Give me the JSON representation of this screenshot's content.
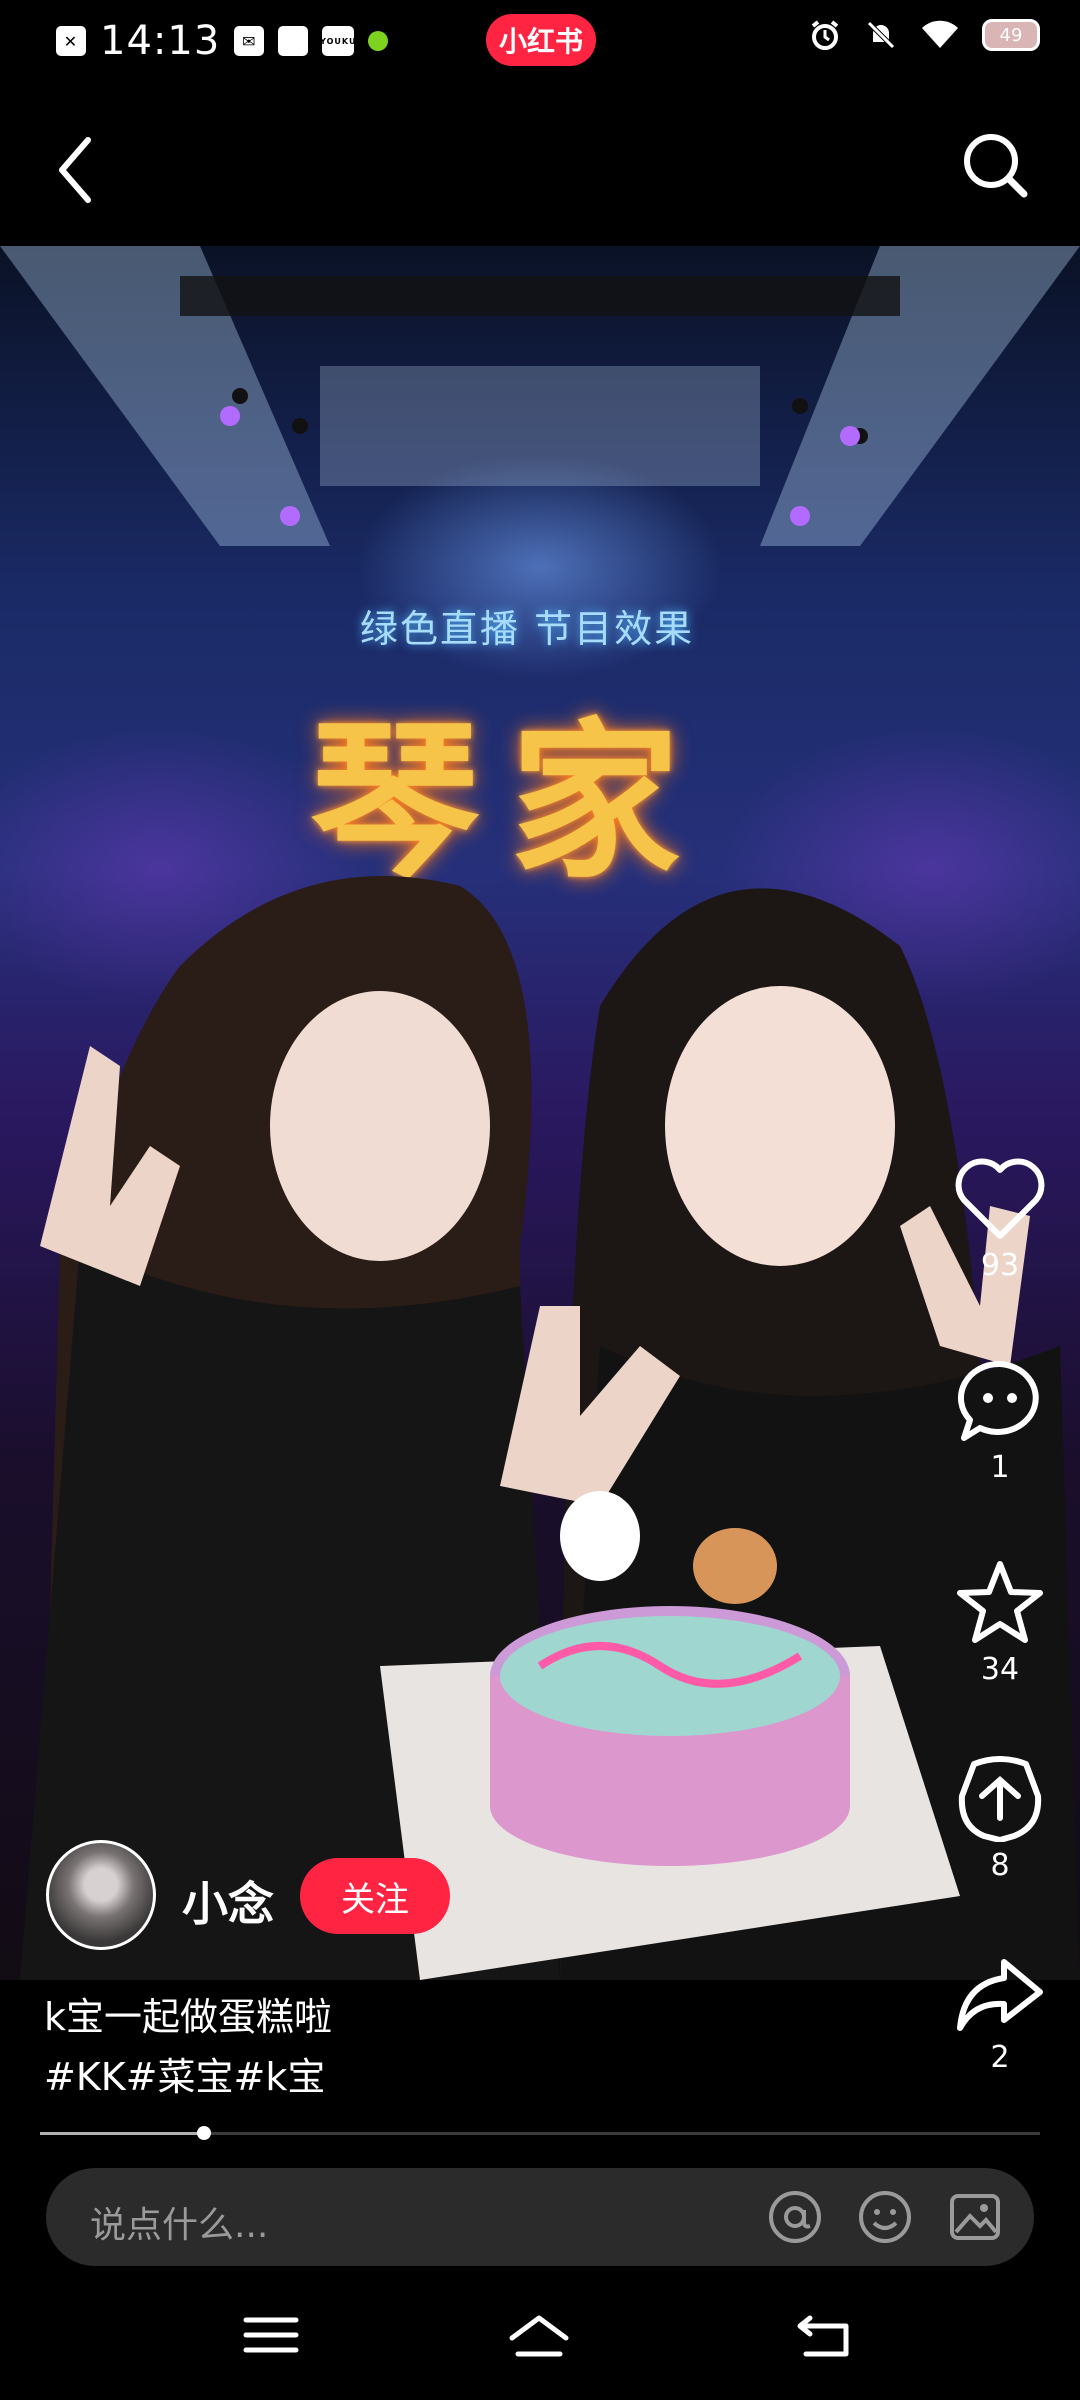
{
  "status_bar": {
    "time": "14:13",
    "brand_label": "小红书",
    "battery": "49",
    "youku_label": "YOUKU"
  },
  "video": {
    "sign_text": "绿色直播 节目效果",
    "title_text": "琴家"
  },
  "actions": {
    "likes": "93",
    "comments": "1",
    "favorites": "34",
    "shares_dialog": "8",
    "shares": "2"
  },
  "author": {
    "name": "小念",
    "follow_label": "关注"
  },
  "post": {
    "caption": "k宝一起做蛋糕啦",
    "hashtags": "#KK#菜宝#k宝"
  },
  "playback": {
    "progress_fraction": 0.164
  },
  "comment_box": {
    "placeholder": "说点什么..."
  },
  "colors": {
    "accent": "#ff2442",
    "background": "#000000"
  },
  "icons": [
    "back-icon",
    "search-icon",
    "heart-icon",
    "comment-icon",
    "star-icon",
    "share-dialog-icon",
    "share-icon",
    "at-icon",
    "emoji-icon",
    "image-icon",
    "menu-icon",
    "home-icon",
    "return-icon"
  ]
}
